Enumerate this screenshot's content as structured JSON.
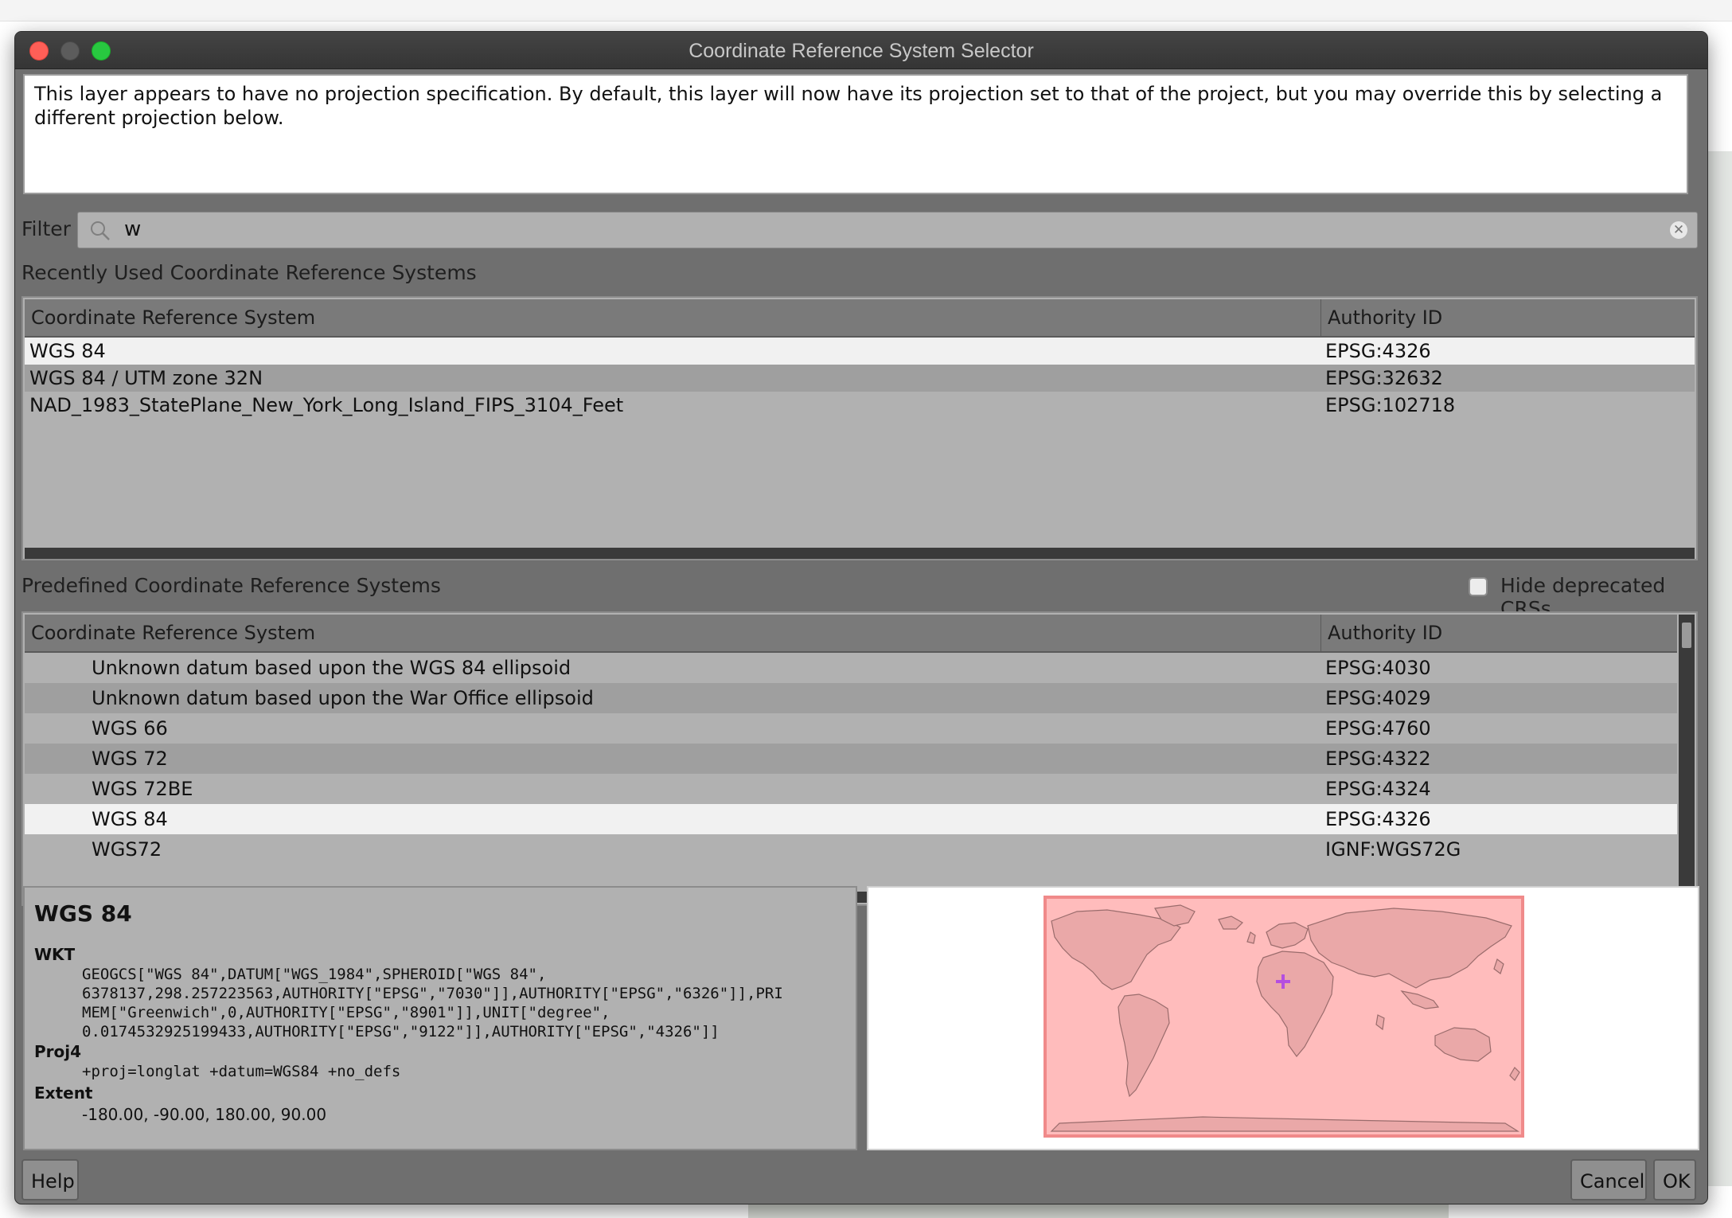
{
  "window": {
    "title": "Coordinate Reference System Selector"
  },
  "message": "This layer appears to have no projection specification. By default, this layer will now have its projection set to that of the project, but you may override this by selecting a different projection below.",
  "filter": {
    "label": "Filter",
    "value": "w"
  },
  "recent": {
    "heading": "Recently Used Coordinate Reference Systems",
    "columns": [
      "Coordinate Reference System",
      "Authority ID"
    ],
    "rows": [
      {
        "name": "WGS 84",
        "id": "EPSG:4326"
      },
      {
        "name": "WGS 84 / UTM zone 32N",
        "id": "EPSG:32632"
      },
      {
        "name": "NAD_1983_StatePlane_New_York_Long_Island_FIPS_3104_Feet",
        "id": "EPSG:102718"
      }
    ]
  },
  "predefined": {
    "heading": "Predefined Coordinate Reference Systems",
    "hide_deprecated_label": "Hide deprecated CRSs",
    "hide_deprecated_checked": false,
    "columns": [
      "Coordinate Reference System",
      "Authority ID"
    ],
    "rows": [
      {
        "name": "Unknown datum based upon the WGS 84 ellipsoid",
        "id": "EPSG:4030"
      },
      {
        "name": "Unknown datum based upon the War Office ellipsoid",
        "id": "EPSG:4029"
      },
      {
        "name": "WGS 66",
        "id": "EPSG:4760"
      },
      {
        "name": "WGS 72",
        "id": "EPSG:4322"
      },
      {
        "name": "WGS 72BE",
        "id": "EPSG:4324"
      },
      {
        "name": "WGS 84",
        "id": "EPSG:4326"
      },
      {
        "name": "WGS72",
        "id": "IGNF:WGS72G"
      }
    ]
  },
  "details": {
    "name": "WGS 84",
    "wkt_label": "WKT",
    "wkt": "GEOGCS[\"WGS 84\",DATUM[\"WGS_1984\",SPHEROID[\"WGS 84\",\n6378137,298.257223563,AUTHORITY[\"EPSG\",\"7030\"]],AUTHORITY[\"EPSG\",\"6326\"]],PRI\nMEM[\"Greenwich\",0,AUTHORITY[\"EPSG\",\"8901\"]],UNIT[\"degree\",\n0.0174532925199433,AUTHORITY[\"EPSG\",\"9122\"]],AUTHORITY[\"EPSG\",\"4326\"]]",
    "proj4_label": "Proj4",
    "proj4": "+proj=longlat +datum=WGS84 +no_defs",
    "extent_label": "Extent",
    "extent": "-180.00, -90.00, 180.00, 90.00"
  },
  "buttons": {
    "help": "Help",
    "cancel": "Cancel",
    "ok": "OK"
  },
  "colors": {
    "selected_row": "#f1f1f1",
    "map_extent_fill": "#ffbcbc",
    "map_extent_border": "#f08a8a",
    "map_marker": "#b44fe0"
  }
}
